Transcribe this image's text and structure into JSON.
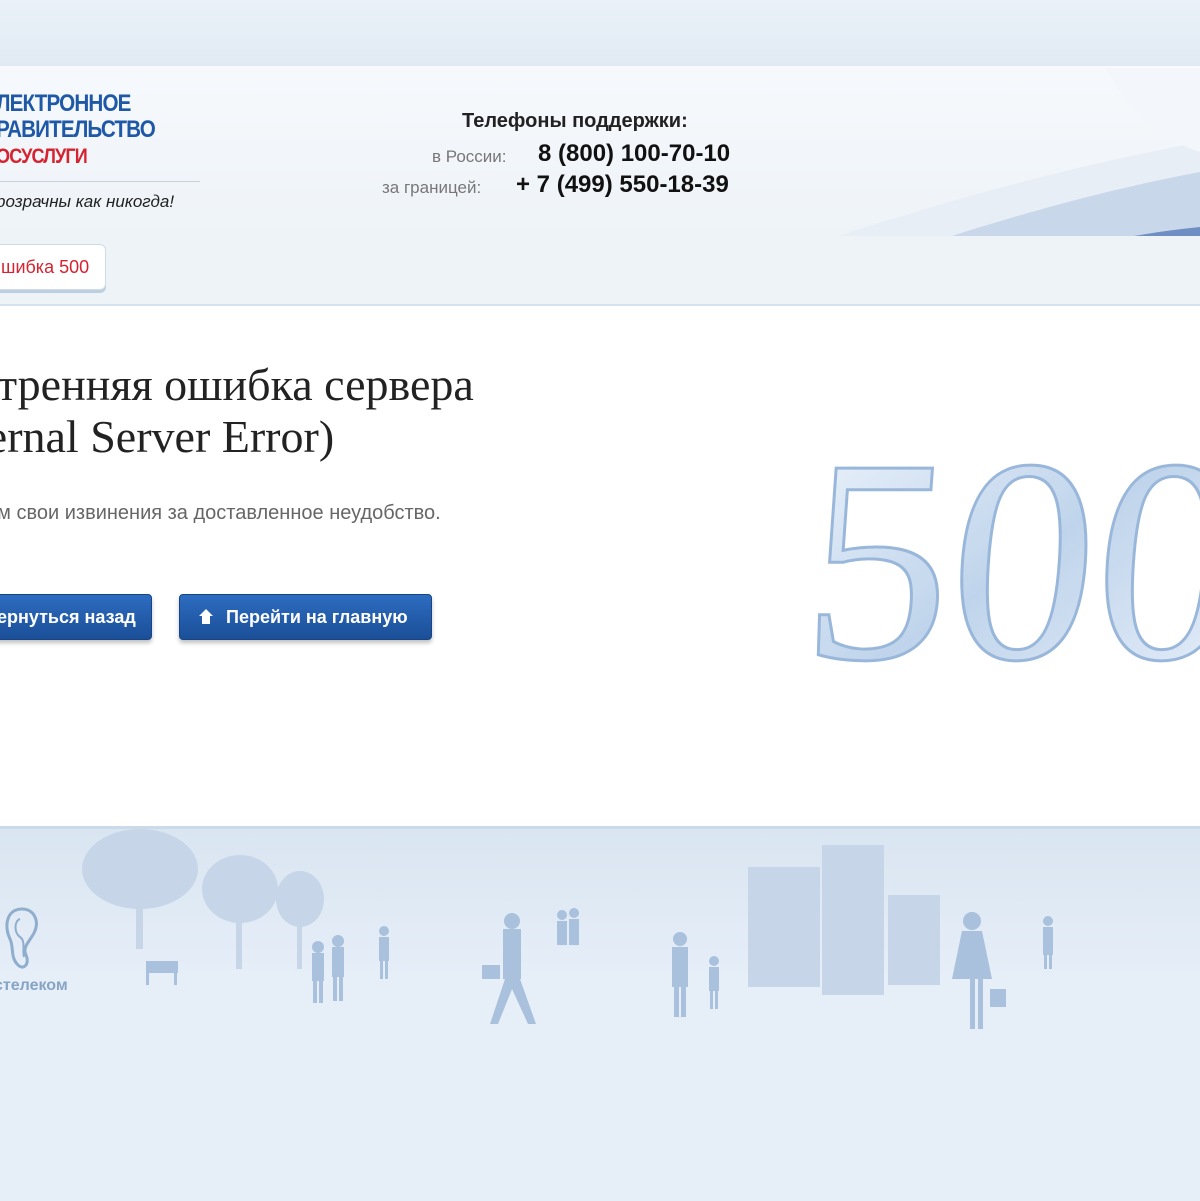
{
  "header": {
    "logo_line1": "ЛЕКТРОННОЕ",
    "logo_line2": "РАВИТЕЛЬСТВО",
    "logo_line3": "ОСУСЛУГИ",
    "slogan": "розрачны как никогда!",
    "support_title": "Телефоны поддержки:",
    "russia_label": "в России:",
    "russia_phone": "8 (800) 100-70-10",
    "abroad_label": "за границей:",
    "abroad_phone": "+ 7 (499) 550-18-39"
  },
  "breadcrumb": {
    "label": "шибка 500"
  },
  "main": {
    "title_line1": "утренняя ошибка сервера",
    "title_line2": "ternal Server Error)",
    "apology": "им свои извинения за доставленное неудобство.",
    "back_button": "ернуться назад",
    "home_button": "Перейти на главную",
    "error_graphic_text": "500"
  },
  "footer": {
    "provider_label": "стелеком"
  },
  "colors": {
    "brand_blue": "#1f58a6",
    "brand_red": "#d5232f",
    "button_blue": "#1b4f98"
  }
}
